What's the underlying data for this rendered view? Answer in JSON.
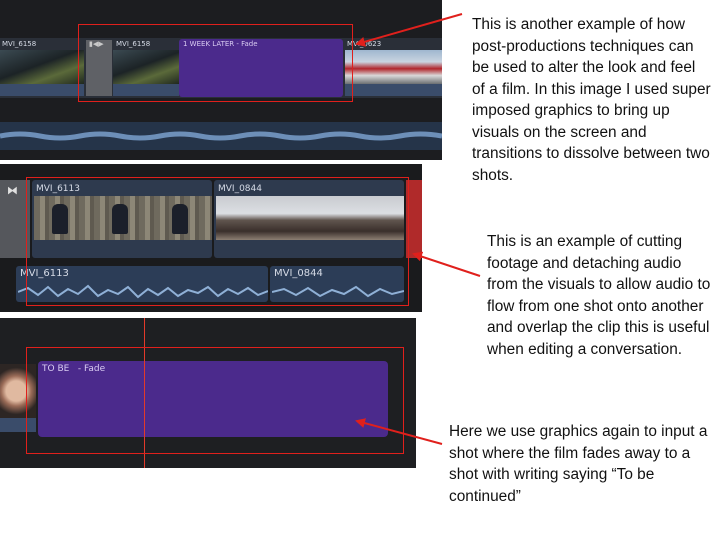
{
  "panel1": {
    "clips": [
      "MVI_6158",
      "MVI_6158",
      "1 WEEK LATER - Fade",
      "MVI_0623"
    ]
  },
  "panel2": {
    "video_clips": [
      "MVI_6113",
      "MVI_0844"
    ],
    "audio_clips": [
      "MVI_6113",
      "MVI_0844"
    ]
  },
  "panel3": {
    "title_clip": "TO BE   - Fade"
  },
  "notes": {
    "note1": "This is another example of how post-productions techniques can be used to alter the look and feel of a film. In this image I used super imposed graphics to bring up visuals on the screen and transitions to dissolve between two shots.",
    "note2": "This is an example of cutting footage and detaching audio from the visuals to allow audio to flow from one shot onto another and overlap the clip this is useful when editing a conversation.",
    "note3": "Here we use graphics again to input a shot where the film fades away to a shot with writing saying “To be continued”"
  },
  "colors": {
    "title_clip": "#4b2a8c",
    "highlight": "#e0201c",
    "playhead": "#e23a2a"
  }
}
